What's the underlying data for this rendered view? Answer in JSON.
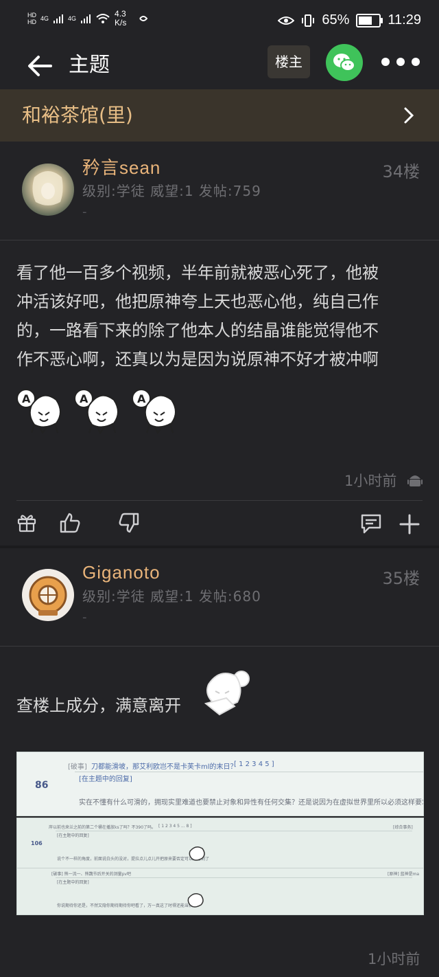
{
  "status_bar": {
    "net_speed": "4.3 K/s",
    "battery": "65%",
    "battery_level": 0.65,
    "time": "11:29",
    "signal_1": "4G",
    "signal_2": "4G"
  },
  "nav": {
    "title": "主题",
    "op_badge": "楼主"
  },
  "forum": {
    "name": "和裕茶馆(里)"
  },
  "posts": [
    {
      "username": "矜言sean",
      "meta": "级别:学徒 威望:1 发帖:759",
      "sub": "-",
      "floor": "34楼",
      "lines": [
        "看了他一百多个视频，半年前就被恶心死了，他被",
        "冲活该好吧，他把原神夸上天也恶心他，纯自己作",
        "的，一路看下来的除了他本人的结晶谁能觉得他不",
        "作不恶心啊，还真以为是因为说原神不好才被冲啊"
      ],
      "time": "1小时前"
    },
    {
      "username": "Giganoto",
      "meta": "级别:学徒 威望:1 发帖:680",
      "sub": "-",
      "floor": "35楼",
      "text": "查楼上成分，满意离开",
      "time": "1小时前"
    }
  ],
  "screenshot_1": {
    "post_number": "86",
    "tag": "[破事]",
    "title": "刀都能滑坡，那艾利欧岂不是卡芙卡ml的末日？",
    "pages": "[ 1 2 3 4 5 ]",
    "sub_tag": "[在主题中的回复]",
    "body": "实在不懂有什么可滑的，拥现实里难道也要禁止对象和异性有任何交集？还是说因为在虚拟世界里所以必须这样要求？"
  },
  "screenshot_2": {
    "post_number": "106",
    "title": "岸以前也来兰之前的第二个桶在播放ks了吗？不390了吗。",
    "pages": "[ 1 2 3 4 5 ... 8 ]",
    "right_tag": "[综合事务]",
    "sub_tag": "[在主题中的回复]",
    "body": "说个不一样的角度，前面说白头的没对，提拉点儿点儿开把原来要否定可以能看到了",
    "title_2": "[破事] 熊一流一、熊魏节后开关的测量pv吧",
    "right_tag_2": "[原神] 蓝神是ma",
    "sub_tag_2": "[在主题中的回复]",
    "body_2": "你说期待你还是，不然又隐你期待期待你吧看了，万一真这了时得还能当铁饭"
  }
}
